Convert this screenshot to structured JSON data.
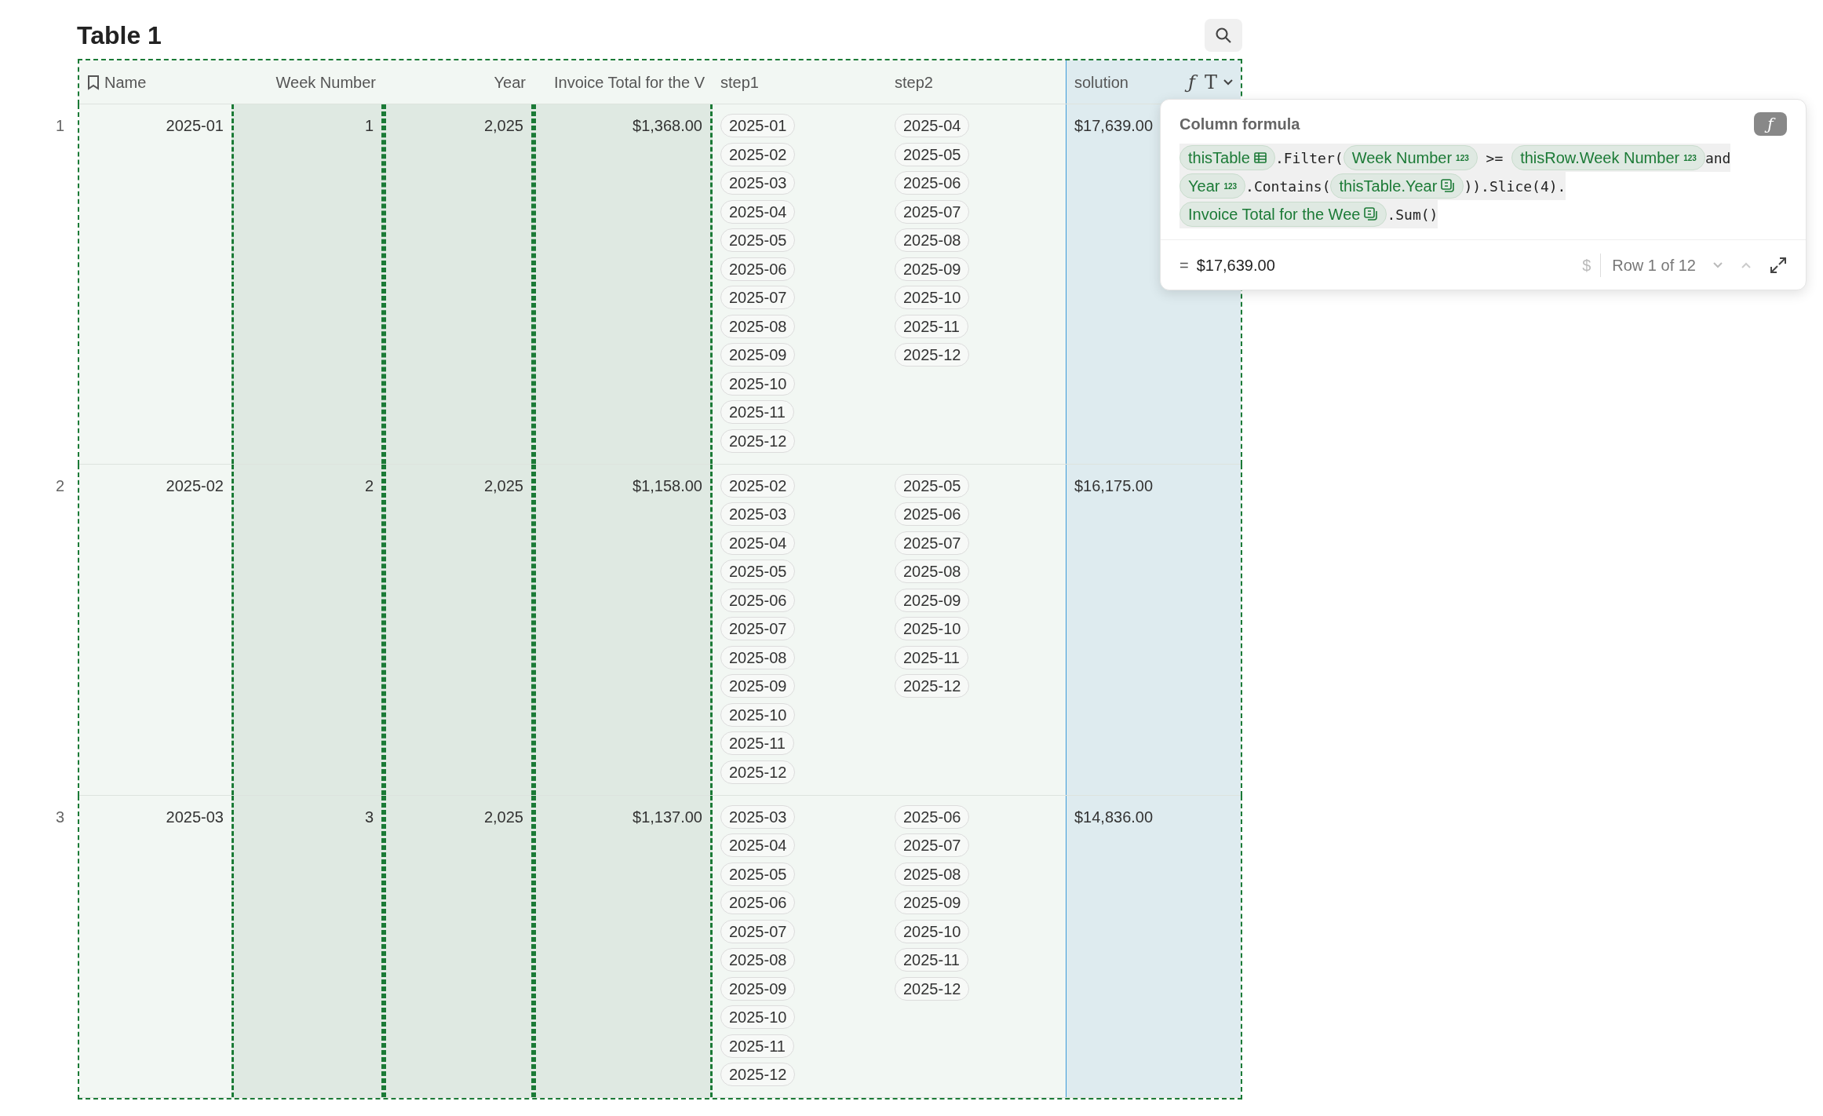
{
  "title": "Table 1",
  "columns": [
    {
      "label": "Name",
      "kind": "name",
      "selected": false,
      "focused": false
    },
    {
      "label": "Week Number",
      "kind": "text",
      "selected": true,
      "focused": false
    },
    {
      "label": "Year",
      "kind": "text",
      "selected": true,
      "focused": false
    },
    {
      "label": "Invoice Total for the V",
      "kind": "text",
      "selected": true,
      "focused": false
    },
    {
      "label": "step1",
      "kind": "chips",
      "selected": false,
      "focused": false
    },
    {
      "label": "step2",
      "kind": "chips",
      "selected": false,
      "focused": false
    },
    {
      "label": "solution",
      "kind": "formula",
      "selected": false,
      "focused": true,
      "icons": [
        "ƒ",
        "T"
      ]
    }
  ],
  "rows": [
    {
      "number": "1",
      "cells": [
        "2025-01",
        "1",
        "2,025",
        "$1,368.00",
        [
          "2025-01",
          "2025-02",
          "2025-03",
          "2025-04",
          "2025-05",
          "2025-06",
          "2025-07",
          "2025-08",
          "2025-09",
          "2025-10",
          "2025-11",
          "2025-12"
        ],
        [
          "2025-04",
          "2025-05",
          "2025-06",
          "2025-07",
          "2025-08",
          "2025-09",
          "2025-10",
          "2025-11",
          "2025-12"
        ],
        "$17,639.00"
      ]
    },
    {
      "number": "2",
      "cells": [
        "2025-02",
        "2",
        "2,025",
        "$1,158.00",
        [
          "2025-02",
          "2025-03",
          "2025-04",
          "2025-05",
          "2025-06",
          "2025-07",
          "2025-08",
          "2025-09",
          "2025-10",
          "2025-11",
          "2025-12"
        ],
        [
          "2025-05",
          "2025-06",
          "2025-07",
          "2025-08",
          "2025-09",
          "2025-10",
          "2025-11",
          "2025-12"
        ],
        "$16,175.00"
      ]
    },
    {
      "number": "3",
      "cells": [
        "2025-03",
        "3",
        "2,025",
        "$1,137.00",
        [
          "2025-03",
          "2025-04",
          "2025-05",
          "2025-06",
          "2025-07",
          "2025-08",
          "2025-09",
          "2025-10",
          "2025-11",
          "2025-12"
        ],
        [
          "2025-06",
          "2025-07",
          "2025-08",
          "2025-09",
          "2025-10",
          "2025-11",
          "2025-12"
        ],
        "$14,836.00"
      ]
    }
  ],
  "popup": {
    "title": "Column formula",
    "button": "ƒ",
    "lines": [
      [
        {
          "kind": "table-ref",
          "text": "thisTable"
        },
        {
          "kind": "code",
          "text": ".Filter("
        },
        {
          "kind": "number-ref",
          "text": "Week Number",
          "badge": "123"
        },
        {
          "kind": "code",
          "text": " >= "
        },
        {
          "kind": "number-ref",
          "text": "thisRow.Week Number",
          "badge": "123"
        },
        {
          "kind": "code",
          "text": "and"
        }
      ],
      [
        {
          "kind": "number-ref",
          "text": "Year",
          "badge": "123"
        },
        {
          "kind": "code",
          "text": ".Contains("
        },
        {
          "kind": "lookup-ref",
          "text": "thisTable.Year"
        },
        {
          "kind": "code",
          "text": ")).Slice(4)."
        }
      ],
      [
        {
          "kind": "lookup-ref",
          "text": "Invoice Total for the Wee"
        },
        {
          "kind": "code",
          "text": ".Sum()"
        }
      ]
    ],
    "result_sign": "=",
    "result": "$17,639.00",
    "currency": "$",
    "row_label": "Row 1 of 12"
  }
}
